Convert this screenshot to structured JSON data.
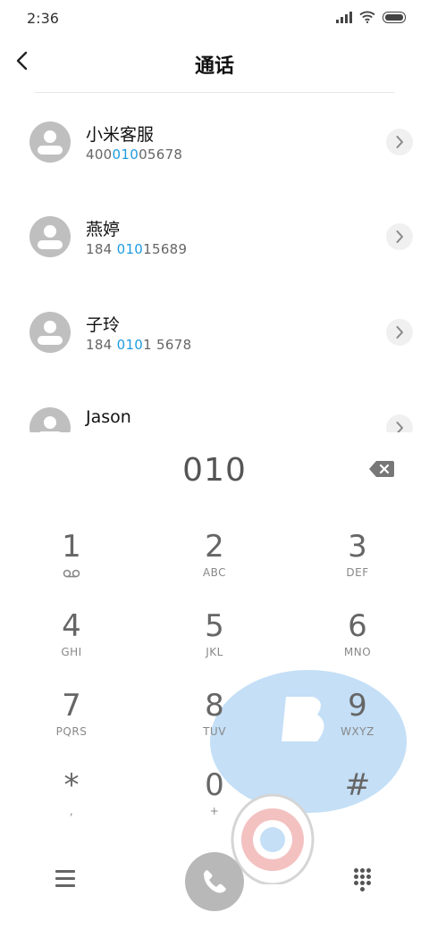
{
  "status_bar": {
    "time": "2:36",
    "icons": [
      "signal-icon",
      "wifi-icon",
      "battery-icon"
    ]
  },
  "header": {
    "title": "通话",
    "back_icon": "chevron-left-icon"
  },
  "contacts": [
    {
      "name": "小米客服",
      "number_pre": "400",
      "number_hl": "010",
      "number_post": "05678"
    },
    {
      "name": "燕婷",
      "number_pre": "184 ",
      "number_hl": "010",
      "number_post": "15689"
    },
    {
      "name": "子玲",
      "number_pre": "184 ",
      "number_hl": "010",
      "number_post": "1 5678"
    },
    {
      "name": "Jason",
      "number_pre": "",
      "number_hl": "",
      "number_post": ""
    }
  ],
  "dial": {
    "number": "010",
    "backspace_icon": "backspace-icon"
  },
  "keypad": [
    {
      "digit": "1",
      "letters": "",
      "icon": "voicemail-icon"
    },
    {
      "digit": "2",
      "letters": "ABC"
    },
    {
      "digit": "3",
      "letters": "DEF"
    },
    {
      "digit": "4",
      "letters": "GHI"
    },
    {
      "digit": "5",
      "letters": "JKL"
    },
    {
      "digit": "6",
      "letters": "MNO"
    },
    {
      "digit": "7",
      "letters": "PQRS"
    },
    {
      "digit": "8",
      "letters": "TUV"
    },
    {
      "digit": "9",
      "letters": "WXYZ"
    },
    {
      "digit": "*",
      "letters": ","
    },
    {
      "digit": "0",
      "letters": "+"
    },
    {
      "digit": "#",
      "letters": ""
    }
  ],
  "bottom_bar": {
    "menu_icon": "menu-icon",
    "call_icon": "phone-icon",
    "keypad_icon": "keypad-icon"
  },
  "colors": {
    "highlight": "#1e9be0",
    "call_button": "#b8b8b8",
    "avatar": "#bfbfbf"
  }
}
